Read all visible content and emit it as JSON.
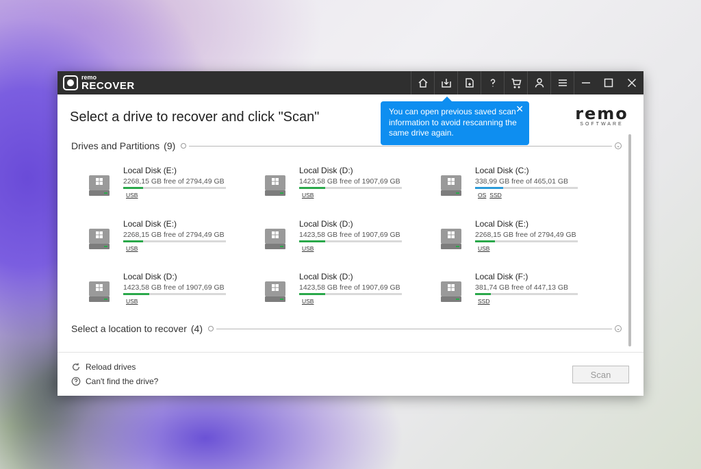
{
  "app": {
    "logo_top": "remo",
    "logo_bottom": "RECOVER",
    "brand_big": "remo",
    "brand_small": "SOFTWARE"
  },
  "page_title": "Select a drive to recover and click \"Scan\"",
  "tooltip": {
    "text": "You can open previous saved scan information to avoid rescanning the same drive again.",
    "close": "✕"
  },
  "sections": {
    "drives": {
      "label": "Drives and Partitions",
      "count": "(9)"
    },
    "locations": {
      "label": "Select a location to recover",
      "count": "(4)"
    }
  },
  "drives": [
    {
      "name": "Local Disk (E:)",
      "free": "2268,15 GB free of 2794,49 GB",
      "tags": [
        "USB"
      ],
      "used_fraction": 0.19,
      "bar_color": "green"
    },
    {
      "name": "Local Disk (D:)",
      "free": "1423,58 GB free of 1907,69 GB",
      "tags": [
        "USB"
      ],
      "used_fraction": 0.25,
      "bar_color": "green"
    },
    {
      "name": "Local Disk (C:)",
      "free": "338,99 GB free of 465,01 GB",
      "tags": [
        "OS",
        "SSD"
      ],
      "used_fraction": 0.27,
      "bar_color": "blue"
    },
    {
      "name": "Local Disk (E:)",
      "free": "2268,15 GB free of 2794,49 GB",
      "tags": [
        "USB"
      ],
      "used_fraction": 0.19,
      "bar_color": "green"
    },
    {
      "name": "Local Disk (D:)",
      "free": "1423,58 GB free of 1907,69 GB",
      "tags": [
        "USB"
      ],
      "used_fraction": 0.25,
      "bar_color": "green"
    },
    {
      "name": "Local Disk (E:)",
      "free": "2268,15 GB free of 2794,49 GB",
      "tags": [
        "USB"
      ],
      "used_fraction": 0.19,
      "bar_color": "green"
    },
    {
      "name": "Local Disk (D:)",
      "free": "1423,58 GB free of 1907,69 GB",
      "tags": [
        "USB"
      ],
      "used_fraction": 0.25,
      "bar_color": "green"
    },
    {
      "name": "Local Disk (D:)",
      "free": "1423,58 GB free of 1907,69 GB",
      "tags": [
        "USB"
      ],
      "used_fraction": 0.25,
      "bar_color": "green"
    },
    {
      "name": "Local Disk (F:)",
      "free": "381,74 GB free of 447,13 GB",
      "tags": [
        "SSD"
      ],
      "used_fraction": 0.15,
      "bar_color": "green"
    }
  ],
  "footer": {
    "reload": "Reload drives",
    "cant_find": "Can't find the drive?",
    "scan": "Scan"
  },
  "colors": {
    "green": "#2aa84a",
    "blue": "#2b9ad8",
    "tooltip": "#0e8ef0"
  },
  "toolbar_icons": [
    "home-icon",
    "open-scan-icon",
    "save-file-icon",
    "help-icon",
    "cart-icon",
    "user-icon",
    "menu-icon",
    "minimize-icon",
    "maximize-icon",
    "close-icon"
  ]
}
